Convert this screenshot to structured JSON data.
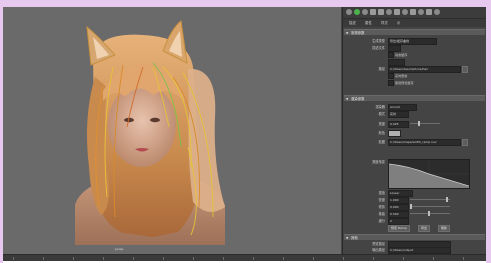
{
  "viewport": {
    "overlay_label": "persp"
  },
  "panel": {
    "tabs": [
      "描述",
      "属性",
      "样式",
      "示"
    ],
    "sections": [
      {
        "id": "s1",
        "label": "常规参数"
      },
      {
        "id": "s2",
        "label": "渲染参数"
      },
      {
        "id": "s3",
        "label": "其他"
      }
    ],
    "rows_a": [
      {
        "label": "生成类型",
        "value": "导出/缓存曲线"
      },
      {
        "label": "描述文件",
        "value": ""
      },
      {
        "label": "",
        "value": ""
      },
      {
        "label": "路径",
        "value": "C:/XGen/descriptions/hair"
      }
    ],
    "checks_a": [
      {
        "label": "动态缓存"
      },
      {
        "label": "实时更新"
      },
      {
        "label": "使用预览缓存"
      }
    ],
    "rows_b": [
      {
        "label": "渲染器",
        "value": "Arnold"
      },
      {
        "label": "模式",
        "value": "实时"
      },
      {
        "label": "宽度",
        "value": "0.025"
      },
      {
        "label": "颜色",
        "value": ""
      },
      {
        "label": "贴图",
        "value": "C:/XGen/maps/width_ramp.xuv"
      }
    ],
    "ramp_label": "宽度渐变",
    "rows_c": [
      {
        "label": "插值",
        "value": "Linear"
      },
      {
        "label": "密度",
        "value": "1.000"
      },
      {
        "label": "修剪",
        "value": "0.000"
      },
      {
        "label": "卷曲",
        "value": "0.500"
      },
      {
        "label": "细分",
        "value": "2"
      }
    ],
    "buttons": [
      "预览 Ramp",
      "导出",
      "刷新"
    ],
    "rows_d": [
      {
        "label": "预览路径",
        "value": ""
      },
      {
        "label": "输出路径",
        "value": "C:/XGen/output"
      }
    ]
  }
}
